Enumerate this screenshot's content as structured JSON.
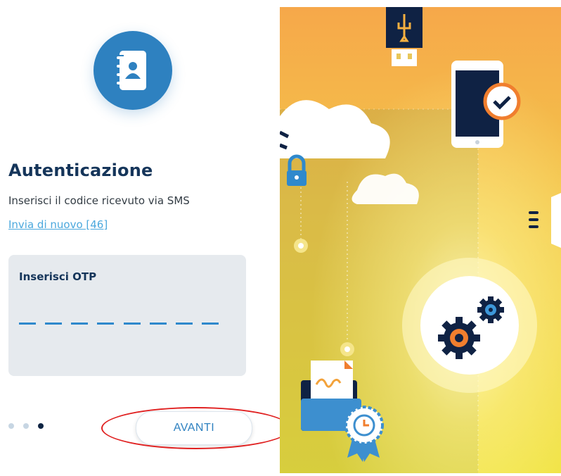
{
  "auth": {
    "title": "Autenticazione",
    "subtitle": "Inserisci il codice ricevuto via SMS",
    "resend_link": "Invia di nuovo [46]"
  },
  "otp": {
    "label": "Inserisci OTP",
    "length": 8,
    "value": ""
  },
  "stepper": {
    "total": 3,
    "current": 3
  },
  "buttons": {
    "next_label": "AVANTI"
  },
  "icons": {
    "header": "address-book-icon",
    "illustration": [
      "usb-key-icon",
      "smartphone-check-icon",
      "cloud-icon",
      "padlock-icon",
      "gears-icon",
      "signed-document-folder-icon",
      "certificate-clock-badge-icon",
      "menu-icon"
    ]
  },
  "colors": {
    "primary": "#2e81c0",
    "title": "#15355a",
    "link": "#4ba8dd",
    "card": "#e6eaee",
    "annotation": "#e02020",
    "illustration_top": "#f7a94a",
    "illustration_bottom": "#f1df3d"
  }
}
